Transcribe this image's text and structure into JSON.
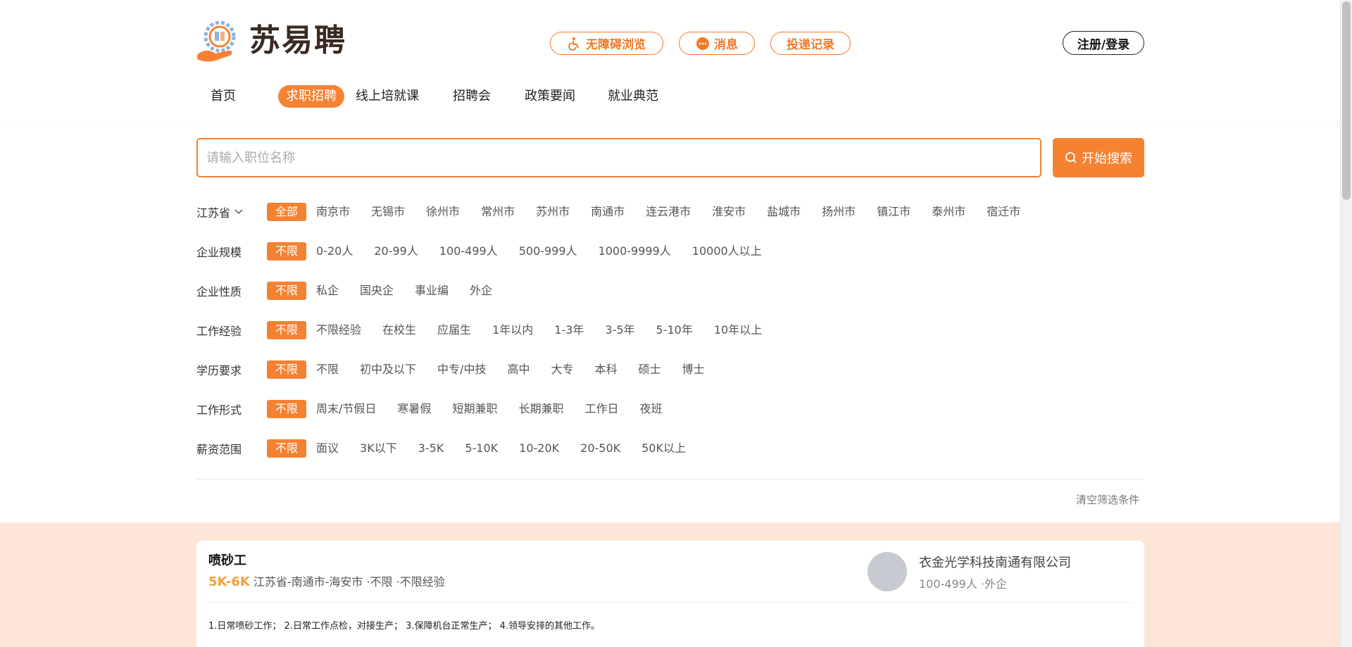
{
  "header": {
    "logo_text": "苏易聘",
    "pills": [
      {
        "label": "无障碍浏览",
        "icon": "wheelchair-icon"
      },
      {
        "label": "消息",
        "icon": "chat-bubble-icon"
      },
      {
        "label": "投递记录",
        "icon": ""
      }
    ],
    "login_label": "注册/登录"
  },
  "nav": {
    "items": [
      "首页",
      "求职招聘",
      "线上培就课",
      "招聘会",
      "政策要闻",
      "就业典范"
    ],
    "active": "求职招聘"
  },
  "search": {
    "placeholder": "请输入职位名称",
    "value": "",
    "button_label": "开始搜索"
  },
  "filters": [
    {
      "label": "江苏省",
      "dropdown": true,
      "selected": "全部",
      "options": [
        "南京市",
        "无锡市",
        "徐州市",
        "常州市",
        "苏州市",
        "南通市",
        "连云港市",
        "淮安市",
        "盐城市",
        "扬州市",
        "镇江市",
        "泰州市",
        "宿迁市"
      ]
    },
    {
      "label": "企业规模",
      "selected": "不限",
      "options": [
        "0-20人",
        "20-99人",
        "100-499人",
        "500-999人",
        "1000-9999人",
        "10000人以上"
      ]
    },
    {
      "label": "企业性质",
      "selected": "不限",
      "options": [
        "私企",
        "国央企",
        "事业编",
        "外企"
      ]
    },
    {
      "label": "工作经验",
      "selected": "不限",
      "options": [
        "不限经验",
        "在校生",
        "应届生",
        "1年以内",
        "1-3年",
        "3-5年",
        "5-10年",
        "10年以上"
      ]
    },
    {
      "label": "学历要求",
      "selected": "不限",
      "options": [
        "不限",
        "初中及以下",
        "中专/中技",
        "高中",
        "大专",
        "本科",
        "硕士",
        "博士"
      ]
    },
    {
      "label": "工作形式",
      "selected": "不限",
      "options": [
        "周末/节假日",
        "寒暑假",
        "短期兼职",
        "长期兼职",
        "工作日",
        "夜班"
      ]
    },
    {
      "label": "薪资范围",
      "selected": "不限",
      "options": [
        "面议",
        "3K以下",
        "3-5K",
        "5-10K",
        "10-20K",
        "20-50K",
        "50K以上"
      ]
    }
  ],
  "clear_filters_label": "清空筛选条件",
  "jobs": [
    {
      "title": "喷砂工",
      "salary": "5K-6K",
      "meta": "江苏省-南通市-海安市 ·不限 ·不限经验",
      "company": "衣金光学科技南通有限公司",
      "company_meta": "100-499人 ·外企",
      "description": "1.日常喷砂工作； 2.日常工作点检，对接生产； 3.保障机台正常生产； 4.领导安排的其他工作。"
    }
  ],
  "colors": {
    "accent": "#f58232",
    "salary": "#f0a040",
    "results_bg": "#fde6d8"
  }
}
